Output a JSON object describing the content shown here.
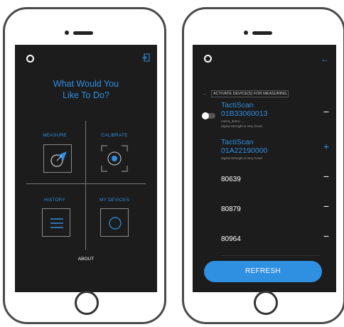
{
  "menu_screen": {
    "title": "What Would You\nLike To Do?",
    "tiles": [
      {
        "label": "MEASURE",
        "icon": "measure-dial-icon"
      },
      {
        "label": "CALIBRATE",
        "icon": "calibrate-target-icon"
      },
      {
        "label": "HISTORY",
        "icon": "history-list-icon"
      },
      {
        "label": "MY DEVICES",
        "icon": "devices-circle-icon"
      }
    ],
    "about_label": "ABOUT",
    "exit_icon": "exit-icon"
  },
  "devices_screen": {
    "activate_label": "ACTIVATE DEVICE(S) FOR MEASURING",
    "devices": [
      {
        "name": "TactiScan\n01B33060013",
        "sub1": "canna_demo......",
        "sub2": "Signal Strength is Very Good",
        "action": "−",
        "toggle": true
      },
      {
        "name": "TactiScan\n01A22190000",
        "sub1": "",
        "sub2": "Signal Strength is Very Good",
        "action": "+",
        "toggle": false
      },
      {
        "name": "80639",
        "action": "−"
      },
      {
        "name": "80879",
        "action": "−"
      },
      {
        "name": "80964",
        "action": "−"
      }
    ],
    "refresh_label": "REFRESH",
    "back_icon": "←"
  },
  "colors": {
    "accent": "#2f8fe0",
    "screen_bg": "#1c1c1c",
    "divider": "#777777"
  }
}
